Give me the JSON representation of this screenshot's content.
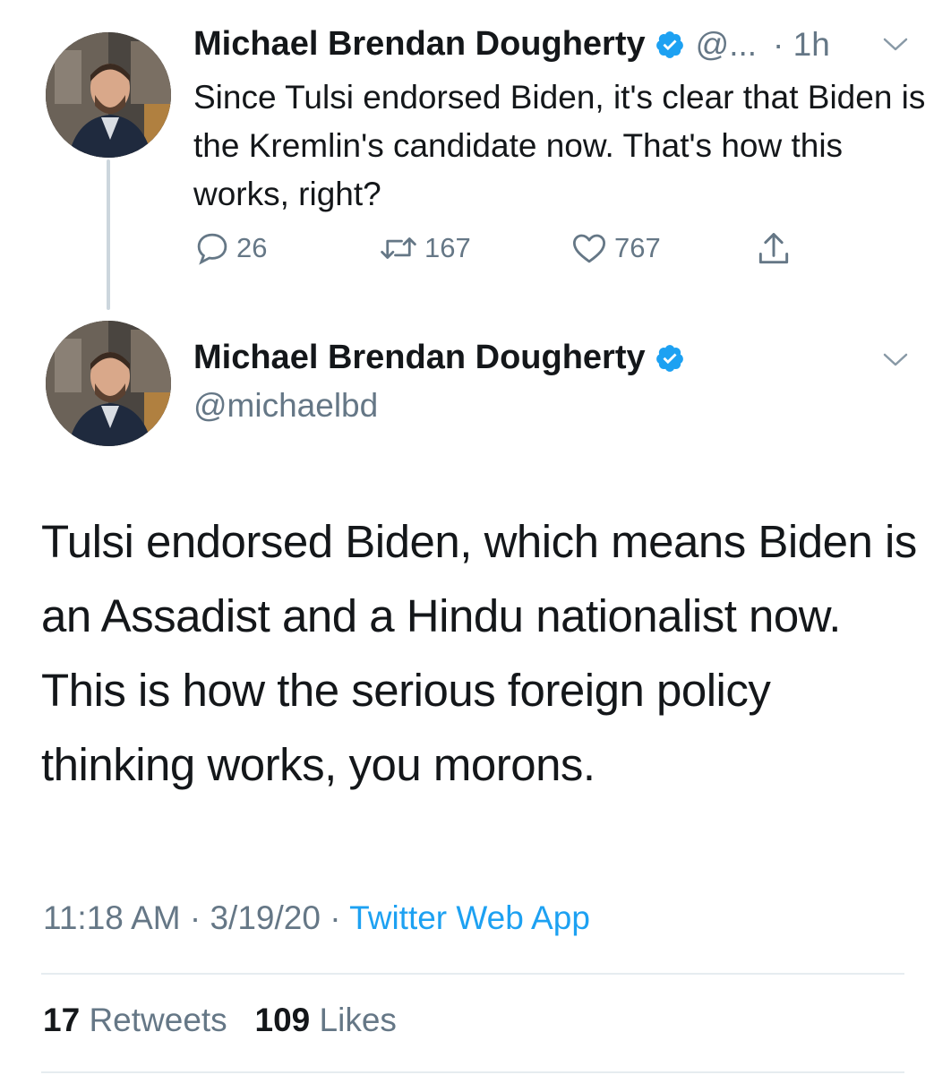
{
  "tweet_reply_parent": {
    "display_name": "Michael Brendan Dougherty",
    "handle_truncated": "@...",
    "time": "· 1h",
    "text": "Since Tulsi endorsed Biden, it's clear that Biden is the Kremlin's candidate now. That's how this works, right?",
    "replies": "26",
    "retweets": "167",
    "likes": "767",
    "icons": [
      "reply-icon",
      "retweet-icon",
      "like-icon",
      "share-icon",
      "verified-badge-icon",
      "chevron-down-icon"
    ]
  },
  "tweet_main": {
    "display_name": "Michael Brendan Dougherty",
    "handle": "@michaelbd",
    "text": "Tulsi endorsed Biden, which means Biden is an Assadist and a Hindu nationalist now. This is how the serious foreign policy thinking works, you morons.",
    "time": "11:18 AM",
    "date": "3/19/20",
    "separator": "·",
    "source": "Twitter Web App",
    "retweet_count": "17",
    "retweet_label": "Retweets",
    "like_count": "109",
    "like_label": "Likes"
  },
  "colors": {
    "text": "#14171a",
    "secondary": "#657786",
    "accent": "#1da1f2",
    "divider": "#e6ecf0",
    "thread_line": "#ccd6dd"
  }
}
